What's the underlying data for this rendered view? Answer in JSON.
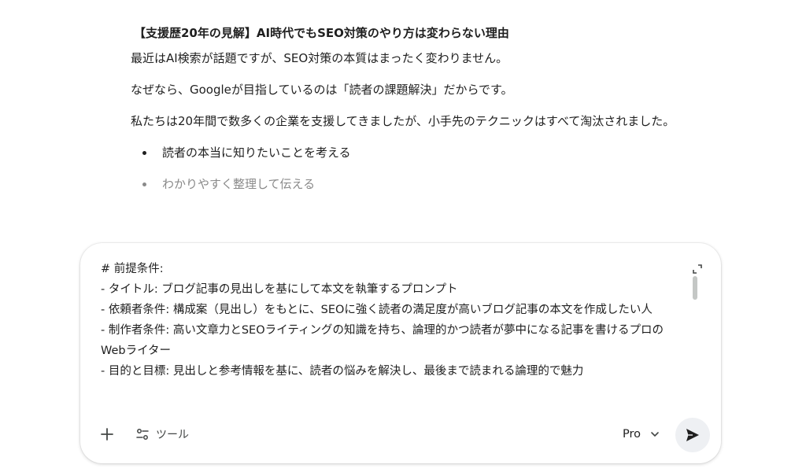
{
  "response": {
    "heading": "【支援歴20年の見解】AI時代でもSEO対策のやり方は変わらない理由",
    "paragraphs": [
      "最近はAI検索が話題ですが、SEO対策の本質はまったく変わりません。",
      "なぜなら、Googleが目指しているのは「読者の課題解決」だからです。",
      "私たちは20年間で数多くの企業を支援してきましたが、小手先のテクニックはすべて淘汰されました。"
    ],
    "bullets": [
      "読者の本当に知りたいことを考える",
      "わかりやすく整理して伝える"
    ]
  },
  "composer": {
    "prompt_text": "# 前提条件:\n- タイトル: ブログ記事の見出しを基にして本文を執筆するプロンプト\n- 依頼者条件: 構成案（見出し）をもとに、SEOに強く読者の満足度が高いブログ記事の本文を作成したい人\n- 制作者条件: 高い文章力とSEOライティングの知識を持ち、論理的かつ読者が夢中になる記事を書けるプロのWebライター\n- 目的と目標: 見出しと参考情報を基に、読者の悩みを解決し、最後まで読まれる論理的で魅力",
    "tools_label": "ツール",
    "model_label": "Pro",
    "icons": {
      "add": "plus-icon",
      "tools": "tune-icon",
      "model": "chevron-down-icon",
      "send": "send-icon",
      "expand": "expand-icon"
    }
  }
}
